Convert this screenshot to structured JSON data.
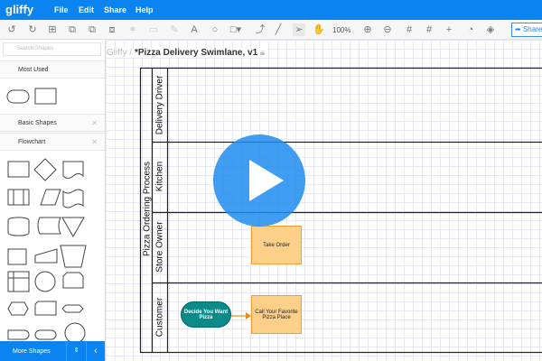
{
  "app": {
    "logo": "gliffy",
    "menu": [
      "File",
      "Edit",
      "Share",
      "Help"
    ]
  },
  "toolbar": {
    "zoom": "100%",
    "share": "Share"
  },
  "sidebar": {
    "search_placeholder": "Search Shapes",
    "sections": [
      "Most Used",
      "Basic Shapes",
      "Flowchart"
    ],
    "more_shapes": "More Shapes"
  },
  "breadcrumb": {
    "root": "Gliffy",
    "separator": "/",
    "doc": "*Pizza Delivery Swimlane, v1"
  },
  "diagram": {
    "pool": "Pizza Ordering Process",
    "lanes": [
      "Delivery Driver",
      "Kitchen",
      "Store Owner",
      "Customer"
    ],
    "shapes": {
      "take_order": "Take Order",
      "decide": "Decide You Want Pizza",
      "call": "Call Your Favorite Pizza Place"
    },
    "colors": {
      "process": "#fdd08a",
      "start": "#0b8a8a",
      "arrow": "#e88a1a"
    }
  }
}
